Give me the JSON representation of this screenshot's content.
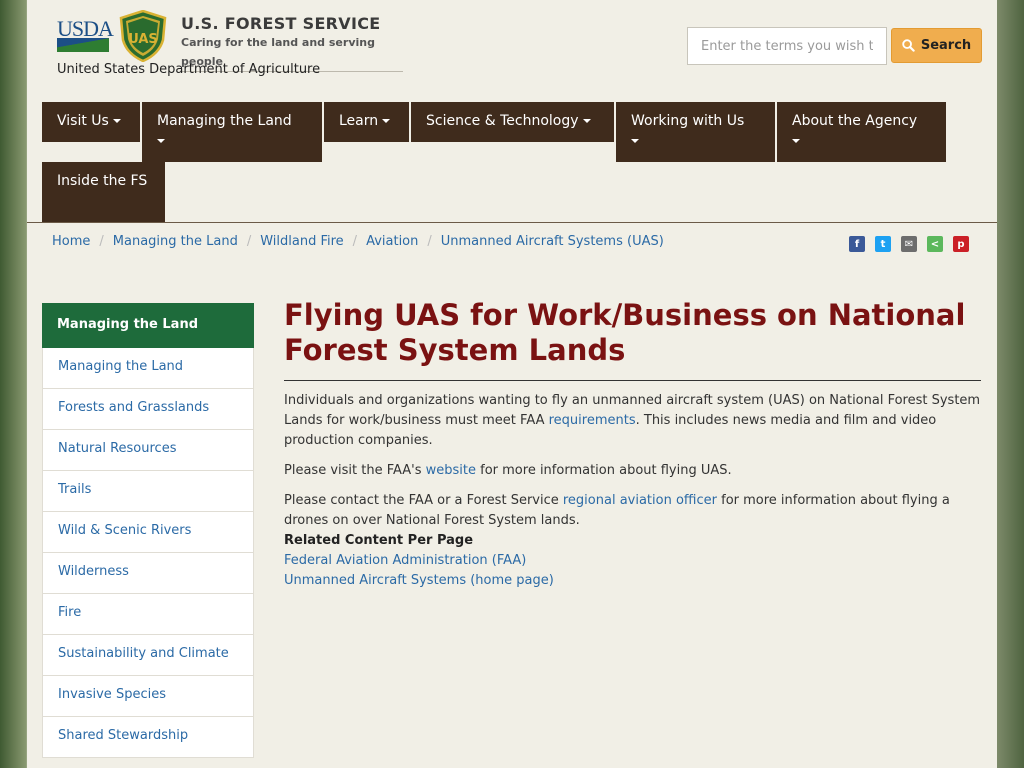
{
  "header": {
    "usda_logo_text": "USDA",
    "agency_title": "U.S. FOREST SERVICE",
    "tagline": "Caring for the land and serving people",
    "department": "United States Department of Agriculture",
    "shield_text": "UAS",
    "search_placeholder": "Enter the terms you wish to search for",
    "search_label": "Search",
    "search_color": "#f0ad4e"
  },
  "nav": {
    "items": [
      {
        "label": "Visit Us"
      },
      {
        "label": "Managing the Land"
      },
      {
        "label": "Learn"
      },
      {
        "label": "Science & Technology"
      },
      {
        "label": "Working with Us"
      },
      {
        "label": "About the Agency"
      },
      {
        "label": "Inside the FS"
      }
    ],
    "color": "#3f2b1c"
  },
  "breadcrumb": [
    "Home",
    "Managing the Land",
    "Wildland Fire",
    "Aviation",
    "Unmanned Aircraft Systems (UAS)"
  ],
  "share_icons": [
    {
      "name": "facebook-icon",
      "glyph": "f",
      "color": "#3b5998"
    },
    {
      "name": "twitter-icon",
      "glyph": "t",
      "color": "#1da1f2"
    },
    {
      "name": "email-icon",
      "glyph": "✉",
      "color": "#6d6d6d"
    },
    {
      "name": "share-icon",
      "glyph": "<",
      "color": "#5cb85c"
    },
    {
      "name": "pinterest-icon",
      "glyph": "p",
      "color": "#cb2027"
    }
  ],
  "sidebar": {
    "heading": "Managing the Land",
    "heading_color": "#1e6b3b",
    "items": [
      "Managing the Land",
      "Forests and Grasslands",
      "Natural Resources",
      "Trails",
      "Wild & Scenic Rivers",
      "Wilderness",
      "Fire",
      "Sustainability and Climate",
      "Invasive Species",
      "Shared Stewardship"
    ]
  },
  "main": {
    "title": "Flying UAS for Work/Business on National Forest System Lands",
    "p1_before": "Individuals and organizations wanting to fly an unmanned aircraft system (UAS) on National Forest System Lands for work/business must meet FAA ",
    "p1_link": "requirements",
    "p1_after": ". This includes news media and film and video production companies.",
    "p2_before": "Please visit the FAA's ",
    "p2_link": "website",
    "p2_after": " for more information about flying UAS.",
    "p3_before": "Please contact the FAA or a Forest Service ",
    "p3_link": "regional aviation officer",
    "p3_after": " for more information about flying a drones on over National Forest System lands.",
    "related_heading": "Related Content Per Page",
    "related_links": [
      "Federal Aviation Administration (FAA)",
      "Unmanned Aircraft Systems (home page)"
    ]
  }
}
